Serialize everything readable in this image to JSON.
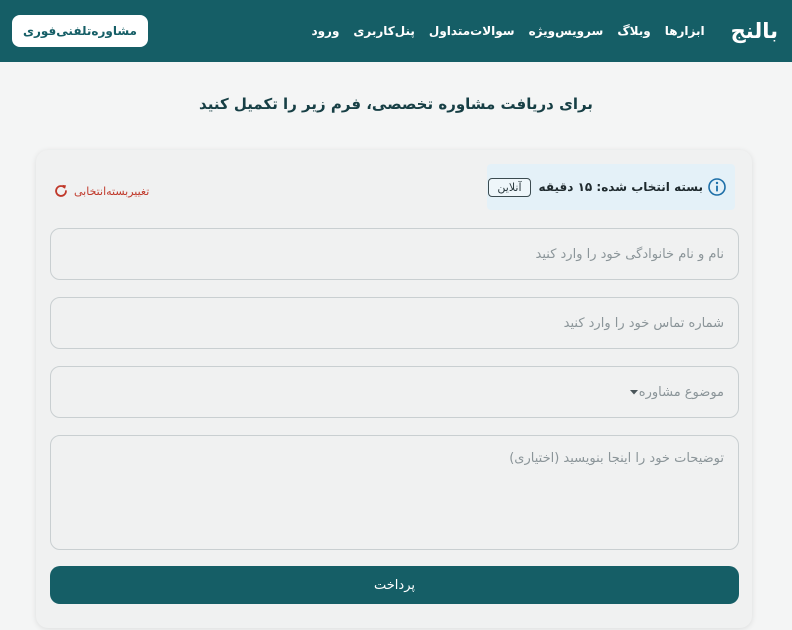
{
  "nav": {
    "brand": "بالنج",
    "links": [
      "ابزارها",
      "وبلاگ",
      "سرویس‌ویژه",
      "سوالات‌متداول",
      "پنل‌کاربری",
      "ورود"
    ],
    "cta": "مشاوره‌تلفنی‌فوری",
    "bg_color": "#155e66"
  },
  "headline": "برای دریافت مشاوره تخصصی، فرم زیر را تکمیل کنید",
  "package": {
    "label": "بسته انتخاب شده: ۱۵ دقیقه",
    "badge": "آنلاین",
    "info_icon": "info-icon"
  },
  "change_package": {
    "label": "تغییربسته‌انتخابی",
    "icon": "refresh-icon",
    "color": "#c0392b"
  },
  "form": {
    "name_placeholder": "نام و نام خانوادگی خود را وارد کنید",
    "phone_placeholder": "شماره تماس خود را وارد کنید",
    "topic_placeholder": "موضوع مشاوره",
    "description_placeholder": "توضیحات خود را اینجا بنویسید (اختیاری)",
    "submit_label": "پرداخت"
  }
}
